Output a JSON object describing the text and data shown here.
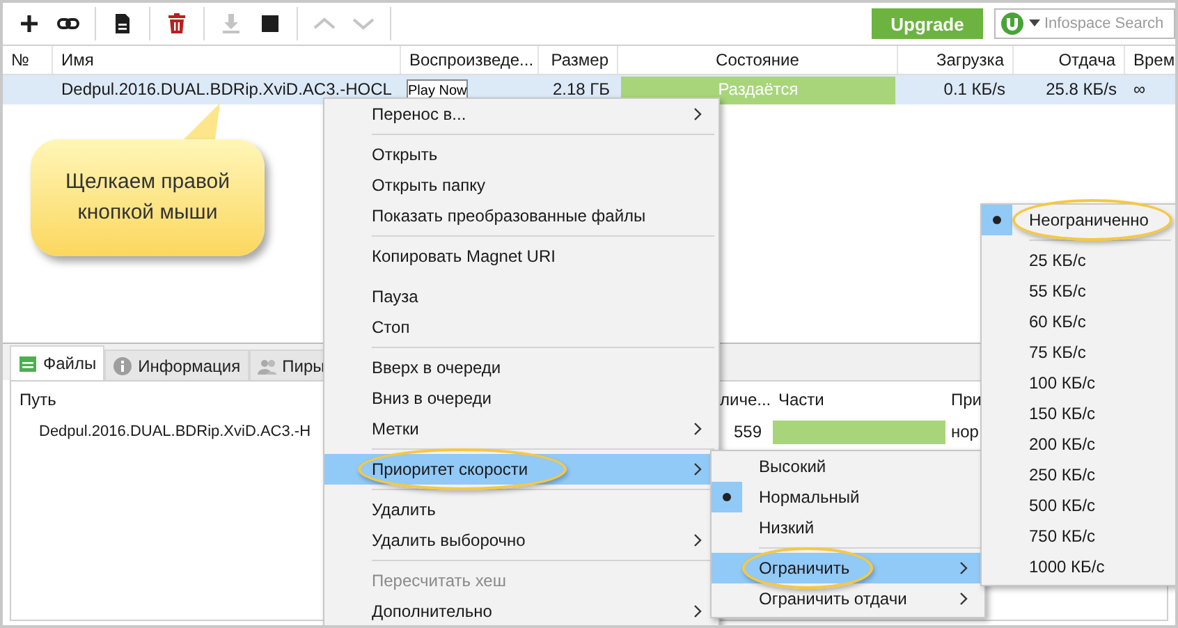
{
  "toolbar": {
    "groups": [
      [
        {
          "kind": "add",
          "disabled": false
        },
        {
          "kind": "link",
          "disabled": false
        }
      ],
      [
        {
          "kind": "file",
          "disabled": false
        }
      ],
      [
        {
          "kind": "delete",
          "disabled": false
        }
      ],
      [
        {
          "kind": "download",
          "disabled": true
        },
        {
          "kind": "stop",
          "disabled": false
        }
      ],
      [
        {
          "kind": "up",
          "disabled": true
        },
        {
          "kind": "down",
          "disabled": true
        }
      ]
    ],
    "upgrade_button": "Upgrade",
    "search": {
      "placeholder": "Infospace Search"
    }
  },
  "torrents": {
    "columns": [
      "№",
      "Имя",
      "Воспроизведе...",
      "Размер",
      "Состояние",
      "Загрузка",
      "Отдача",
      "Врем"
    ],
    "rows": [
      {
        "selected": true,
        "name": "Dedpul.2016.DUAL.BDRip.XviD.AC3.-HOCL",
        "play": "Play Now",
        "size": "2.18 ГБ",
        "status": "Раздаётся",
        "level": 1,
        "download": "0.1 КБ/s",
        "upload": "25.8 КБ/s",
        "time": "∞"
      }
    ]
  },
  "callout": {
    "text": "Щелкаем правой кнопкой мыши"
  },
  "detail_tabs": [
    {
      "kind": "files",
      "label": "Файлы",
      "selected": true
    },
    {
      "kind": "info",
      "label": "Информация",
      "selected": false
    },
    {
      "kind": "peers",
      "label": "Пиры",
      "selected": false
    }
  ],
  "files": {
    "columns": [
      "Путь",
      "личе...",
      "Части",
      "При"
    ],
    "rows": [
      {
        "path": "Dedpul.2016.DUAL.BDRip.XviD.AC3.-H",
        "count": "559",
        "level": 1,
        "priority": "нор"
      }
    ]
  },
  "context_menu": {
    "items": [
      {
        "kind": "item",
        "label": "Перенос в...",
        "submenu": true,
        "selected": false,
        "disabled": false
      },
      {
        "kind": "separator"
      },
      {
        "kind": "item",
        "label": "Открыть",
        "submenu": false,
        "selected": false,
        "disabled": false
      },
      {
        "kind": "item",
        "label": "Открыть папку",
        "submenu": false,
        "selected": false,
        "disabled": false
      },
      {
        "kind": "item",
        "label": "Показать преобразованные файлы",
        "submenu": false,
        "selected": false,
        "disabled": false
      },
      {
        "kind": "separator"
      },
      {
        "kind": "item",
        "label": "Копировать Magnet URI",
        "submenu": false,
        "selected": false,
        "disabled": false
      },
      {
        "kind": "gap"
      },
      {
        "kind": "item",
        "label": "Пауза",
        "submenu": false,
        "selected": false,
        "disabled": false
      },
      {
        "kind": "item",
        "label": "Стоп",
        "submenu": false,
        "selected": false,
        "disabled": false
      },
      {
        "kind": "separator"
      },
      {
        "kind": "item",
        "label": "Вверх в очереди",
        "submenu": false,
        "selected": false,
        "disabled": false
      },
      {
        "kind": "item",
        "label": "Вниз в очереди",
        "submenu": false,
        "selected": false,
        "disabled": false
      },
      {
        "kind": "item",
        "label": "Метки",
        "submenu": true,
        "selected": false,
        "disabled": false
      },
      {
        "kind": "separator"
      },
      {
        "kind": "item",
        "label": "Приоритет скорости",
        "submenu": true,
        "selected": true,
        "disabled": false,
        "annotated": true
      },
      {
        "kind": "separator"
      },
      {
        "kind": "item",
        "label": "Удалить",
        "submenu": false,
        "selected": false,
        "disabled": false
      },
      {
        "kind": "item",
        "label": "Удалить выборочно",
        "submenu": true,
        "selected": false,
        "disabled": false
      },
      {
        "kind": "separator"
      },
      {
        "kind": "item",
        "label": "Пересчитать хеш",
        "submenu": false,
        "selected": false,
        "disabled": true
      },
      {
        "kind": "item",
        "label": "Дополнительно",
        "submenu": true,
        "selected": false,
        "disabled": false
      }
    ]
  },
  "priority_menu": {
    "items": [
      {
        "kind": "item",
        "label": "Высокий",
        "checked": false,
        "submenu": false,
        "selected": false
      },
      {
        "kind": "item",
        "label": "Нормальный",
        "checked": true,
        "submenu": false,
        "selected": false
      },
      {
        "kind": "item",
        "label": "Низкий",
        "checked": false,
        "submenu": false,
        "selected": false
      },
      {
        "kind": "separator"
      },
      {
        "kind": "item",
        "label": "Ограничить",
        "checked": false,
        "submenu": true,
        "selected": true,
        "annotated": true
      },
      {
        "kind": "item",
        "label": "Ограничить отдачи",
        "checked": false,
        "submenu": true,
        "selected": false
      }
    ]
  },
  "limit_menu": {
    "items": [
      {
        "kind": "item",
        "label": "Неограниченно",
        "checked": true,
        "selected": false,
        "annotated": true
      },
      {
        "kind": "separator"
      },
      {
        "kind": "item",
        "label": "25 КБ/с",
        "checked": false,
        "selected": false
      },
      {
        "kind": "item",
        "label": "55 КБ/с",
        "checked": false,
        "selected": false
      },
      {
        "kind": "item",
        "label": "60 КБ/с",
        "checked": false,
        "selected": false
      },
      {
        "kind": "item",
        "label": "75 КБ/с",
        "checked": false,
        "selected": false
      },
      {
        "kind": "item",
        "label": "100 КБ/с",
        "checked": false,
        "selected": false
      },
      {
        "kind": "item",
        "label": "150 КБ/с",
        "checked": false,
        "selected": false
      },
      {
        "kind": "item",
        "label": "200 КБ/с",
        "checked": false,
        "selected": false
      },
      {
        "kind": "item",
        "label": "250 КБ/с",
        "checked": false,
        "selected": false
      },
      {
        "kind": "item",
        "label": "500 КБ/с",
        "checked": false,
        "selected": false
      },
      {
        "kind": "item",
        "label": "750 КБ/с",
        "checked": false,
        "selected": false
      },
      {
        "kind": "item",
        "label": "1000 КБ/с",
        "checked": false,
        "selected": false
      }
    ]
  }
}
